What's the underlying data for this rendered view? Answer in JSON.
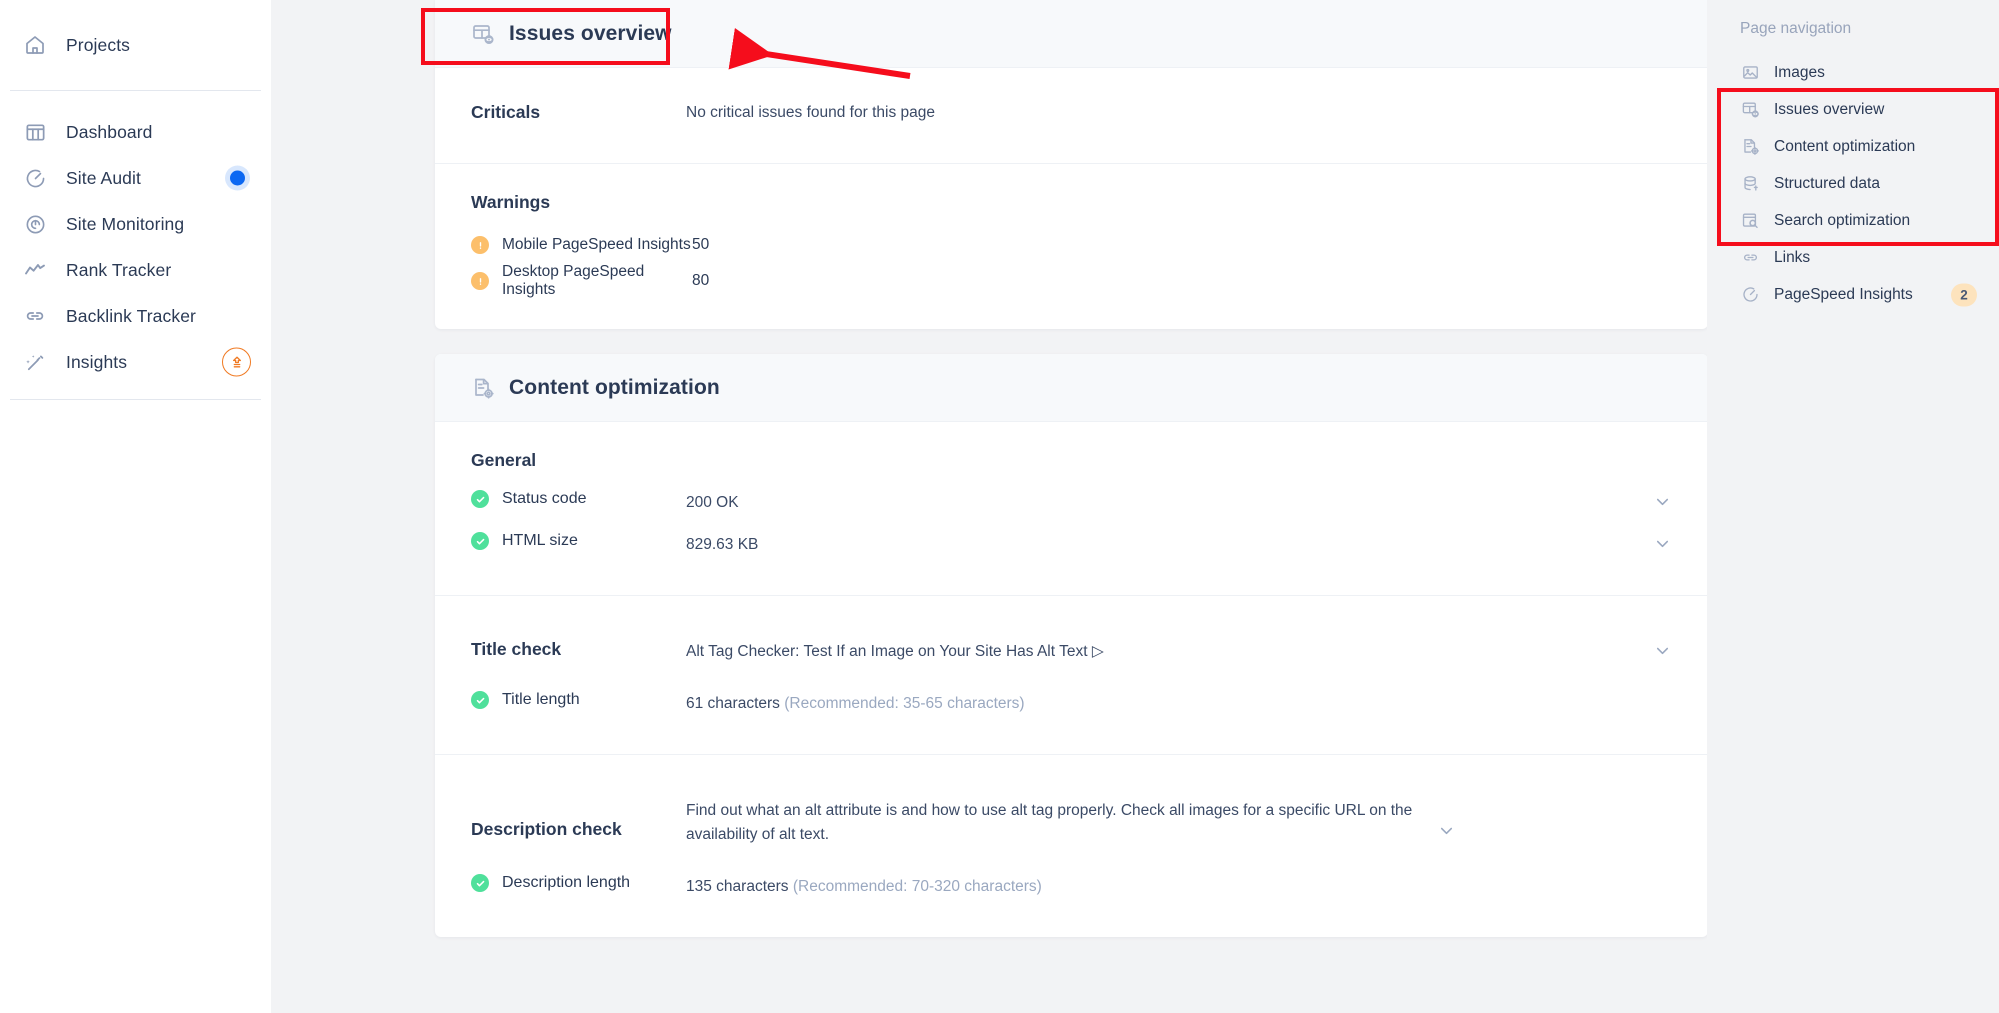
{
  "sidebar": {
    "top_items": [
      {
        "label": "Projects",
        "icon": "home-icon"
      }
    ],
    "items": [
      {
        "label": "Dashboard",
        "icon": "dashboard-icon",
        "indicator": "none"
      },
      {
        "label": "Site Audit",
        "icon": "site-audit-icon",
        "indicator": "dot"
      },
      {
        "label": "Site Monitoring",
        "icon": "site-monitoring-icon",
        "indicator": "none"
      },
      {
        "label": "Rank Tracker",
        "icon": "rank-tracker-icon",
        "indicator": "none"
      },
      {
        "label": "Backlink Tracker",
        "icon": "backlink-tracker-icon",
        "indicator": "none"
      },
      {
        "label": "Insights",
        "icon": "insights-wand-icon",
        "indicator": "upgrade"
      }
    ]
  },
  "issues_card": {
    "title": "Issues overview",
    "icon": "issues-overview-icon",
    "criticals": {
      "label": "Criticals",
      "value": "No critical issues found for this page"
    },
    "warnings": {
      "label": "Warnings",
      "items": [
        {
          "name": "Mobile PageSpeed Insights",
          "value": "50"
        },
        {
          "name": "Desktop PageSpeed Insights",
          "value": "80"
        }
      ]
    }
  },
  "content_card": {
    "title": "Content optimization",
    "icon": "content-optimization-icon",
    "general": {
      "label": "General",
      "rows": [
        {
          "label": "Status code",
          "value": "200 OK",
          "status": "ok",
          "value_style": "green",
          "chevron": true
        },
        {
          "label": "HTML size",
          "value": "829.63 KB",
          "status": "ok",
          "value_style": "normal",
          "chevron": true
        }
      ]
    },
    "title_check": {
      "label": "Title check",
      "value": "Alt Tag Checker: Test If an Image on Your Site Has Alt Text ▷",
      "chevron": true,
      "sub": {
        "label": "Title length",
        "value": "61 characters",
        "hint": "(Recommended: 35-65 characters)",
        "status": "ok"
      }
    },
    "description_check": {
      "label": "Description check",
      "value": "Find out what an alt attribute is and how to use alt tag properly. Check all images for a specific URL on the availability of alt text.",
      "chevron": true,
      "sub": {
        "label": "Description length",
        "value": "135 characters",
        "hint": "(Recommended: 70-320 characters)",
        "status": "ok"
      }
    }
  },
  "page_navigation": {
    "title": "Page navigation",
    "items": [
      {
        "label": "Images",
        "icon": "images-icon",
        "badge": ""
      },
      {
        "label": "Issues overview",
        "icon": "issues-overview-icon",
        "badge": ""
      },
      {
        "label": "Content optimization",
        "icon": "content-optimization-icon",
        "badge": ""
      },
      {
        "label": "Structured data",
        "icon": "structured-data-icon",
        "badge": ""
      },
      {
        "label": "Search optimization",
        "icon": "search-optimization-icon",
        "badge": ""
      },
      {
        "label": "Links",
        "icon": "links-icon",
        "badge": ""
      },
      {
        "label": "PageSpeed Insights",
        "icon": "pagespeed-icon",
        "badge": "2"
      }
    ]
  },
  "colors": {
    "accent_blue": "#0c68f2",
    "annotation_red": "#f50d1c",
    "warning_orange": "#fcbf6b",
    "success_green": "#4fe09b",
    "status_green_text": "#5fd39a",
    "upgrade_orange": "#f07a23",
    "badge_bg": "#fde3bd",
    "page_bg": "#f2f3f5"
  }
}
